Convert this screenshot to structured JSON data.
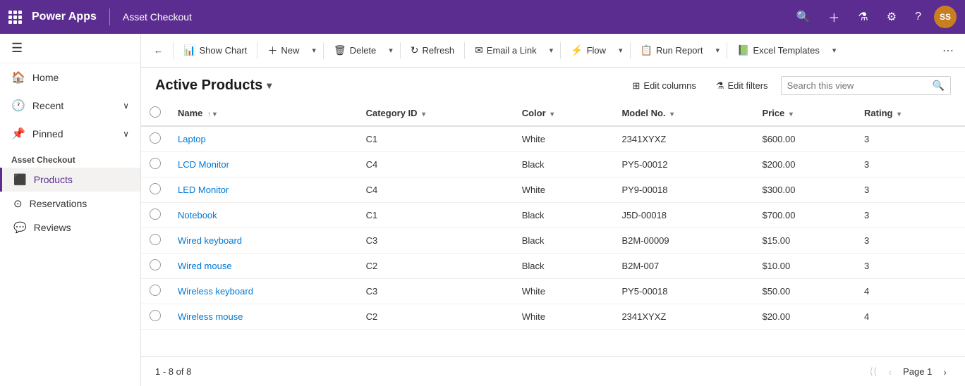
{
  "topNav": {
    "appName": "Power Apps",
    "appTitle": "Asset Checkout",
    "avatarInitials": "SS",
    "icons": {
      "search": "🔍",
      "add": "+",
      "filter": "⚗",
      "settings": "⚙",
      "help": "?"
    }
  },
  "sidebar": {
    "navItems": [
      {
        "id": "home",
        "label": "Home",
        "icon": "🏠"
      },
      {
        "id": "recent",
        "label": "Recent",
        "icon": "🕐",
        "hasChevron": true
      },
      {
        "id": "pinned",
        "label": "Pinned",
        "icon": "📌",
        "hasChevron": true
      }
    ],
    "sectionTitle": "Asset Checkout",
    "appItems": [
      {
        "id": "products",
        "label": "Products",
        "icon": "📦",
        "active": true
      },
      {
        "id": "reservations",
        "label": "Reservations",
        "icon": "⊙"
      },
      {
        "id": "reviews",
        "label": "Reviews",
        "icon": "💬"
      }
    ]
  },
  "commandBar": {
    "backIcon": "←",
    "buttons": [
      {
        "id": "show-chart",
        "label": "Show Chart",
        "icon": "📊"
      },
      {
        "id": "new",
        "label": "New",
        "icon": "+"
      },
      {
        "id": "delete",
        "label": "Delete",
        "icon": "🗑"
      },
      {
        "id": "refresh",
        "label": "Refresh",
        "icon": "↻"
      },
      {
        "id": "email-link",
        "label": "Email a Link",
        "icon": "✉"
      },
      {
        "id": "flow",
        "label": "Flow",
        "icon": "⚡"
      },
      {
        "id": "run-report",
        "label": "Run Report",
        "icon": "📋"
      },
      {
        "id": "excel-templates",
        "label": "Excel Templates",
        "icon": "📗"
      }
    ]
  },
  "view": {
    "title": "Active Products",
    "editColumnsLabel": "Edit columns",
    "editFiltersLabel": "Edit filters",
    "searchPlaceholder": "Search this view"
  },
  "table": {
    "columns": [
      {
        "id": "name",
        "label": "Name",
        "sortable": true,
        "sortDir": "asc"
      },
      {
        "id": "category",
        "label": "Category ID",
        "sortable": true
      },
      {
        "id": "color",
        "label": "Color",
        "sortable": true
      },
      {
        "id": "model",
        "label": "Model No.",
        "sortable": true
      },
      {
        "id": "price",
        "label": "Price",
        "sortable": true
      },
      {
        "id": "rating",
        "label": "Rating",
        "sortable": true
      }
    ],
    "rows": [
      {
        "name": "Laptop",
        "category": "C1",
        "color": "White",
        "model": "2341XYXZ",
        "price": "$600.00",
        "rating": "3"
      },
      {
        "name": "LCD Monitor",
        "category": "C4",
        "color": "Black",
        "model": "PY5-00012",
        "price": "$200.00",
        "rating": "3"
      },
      {
        "name": "LED Monitor",
        "category": "C4",
        "color": "White",
        "model": "PY9-00018",
        "price": "$300.00",
        "rating": "3"
      },
      {
        "name": "Notebook",
        "category": "C1",
        "color": "Black",
        "model": "J5D-00018",
        "price": "$700.00",
        "rating": "3"
      },
      {
        "name": "Wired keyboard",
        "category": "C3",
        "color": "Black",
        "model": "B2M-00009",
        "price": "$15.00",
        "rating": "3"
      },
      {
        "name": "Wired mouse",
        "category": "C2",
        "color": "Black",
        "model": "B2M-007",
        "price": "$10.00",
        "rating": "3"
      },
      {
        "name": "Wireless keyboard",
        "category": "C3",
        "color": "White",
        "model": "PY5-00018",
        "price": "$50.00",
        "rating": "4"
      },
      {
        "name": "Wireless mouse",
        "category": "C2",
        "color": "White",
        "model": "2341XYXZ",
        "price": "$20.00",
        "rating": "4"
      }
    ]
  },
  "footer": {
    "countText": "1 - 8 of 8",
    "pageLabel": "Page 1"
  }
}
